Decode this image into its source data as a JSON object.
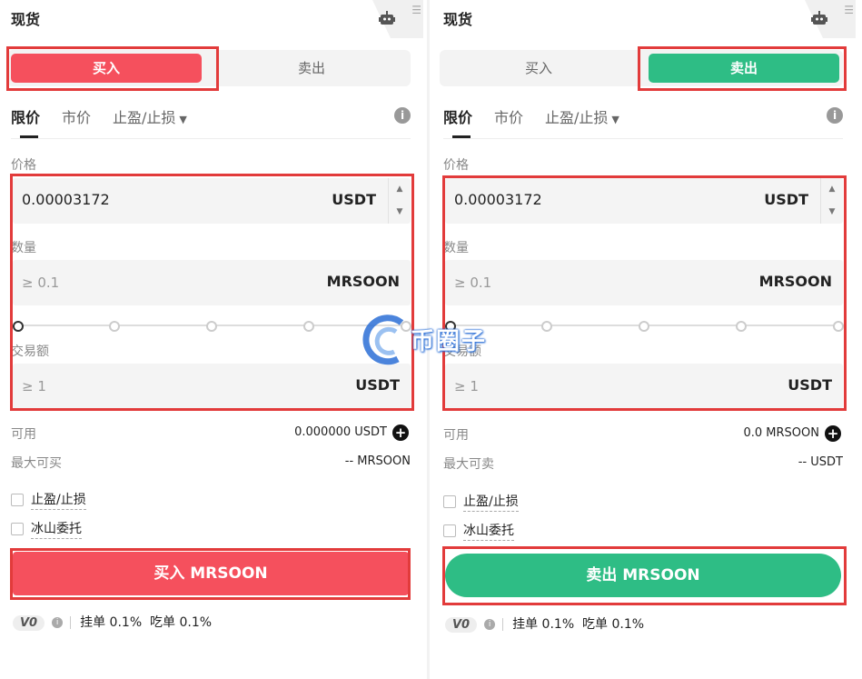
{
  "left": {
    "title": "现货",
    "tabs": {
      "buy": "买入",
      "sell": "卖出"
    },
    "order_tabs": [
      "限价",
      "市价",
      "止盈/止损"
    ],
    "price_label": "价格",
    "price_value": "0.00003172",
    "price_unit": "USDT",
    "qty_label": "数量",
    "qty_placeholder": "≥ 0.1",
    "qty_unit": "MRSOON",
    "total_label": "交易额",
    "total_placeholder": "≥ 1",
    "total_unit": "USDT",
    "avail_label": "可用",
    "avail_value": "0.000000 USDT",
    "max_label": "最大可买",
    "max_value": "-- MRSOON",
    "chk_tpsl": "止盈/止损",
    "chk_iceberg": "冰山委托",
    "submit": "买入 MRSOON",
    "vip": "V0",
    "maker": "挂单 0.1%",
    "taker": "吃单 0.1%"
  },
  "right": {
    "title": "现货",
    "tabs": {
      "buy": "买入",
      "sell": "卖出"
    },
    "order_tabs": [
      "限价",
      "市价",
      "止盈/止损"
    ],
    "price_label": "价格",
    "price_value": "0.00003172",
    "price_unit": "USDT",
    "qty_label": "数量",
    "qty_placeholder": "≥ 0.1",
    "qty_unit": "MRSOON",
    "total_label": "交易额",
    "total_placeholder": "≥ 1",
    "total_unit": "USDT",
    "avail_label": "可用",
    "avail_value": "0.0 MRSOON",
    "max_label": "最大可卖",
    "max_value": "-- USDT",
    "chk_tpsl": "止盈/止损",
    "chk_iceberg": "冰山委托",
    "submit": "卖出 MRSOON",
    "vip": "V0",
    "maker": "挂单 0.1%",
    "taker": "吃单 0.1%"
  },
  "watermark": "币圈子",
  "colors": {
    "buy": "#f5505d",
    "sell": "#2ebd85",
    "highlight": "#e23b3b"
  },
  "icons": [
    "robot-icon",
    "info-icon",
    "plus-circle-icon",
    "caret-down-icon",
    "arrow-up-icon",
    "arrow-down-icon"
  ]
}
